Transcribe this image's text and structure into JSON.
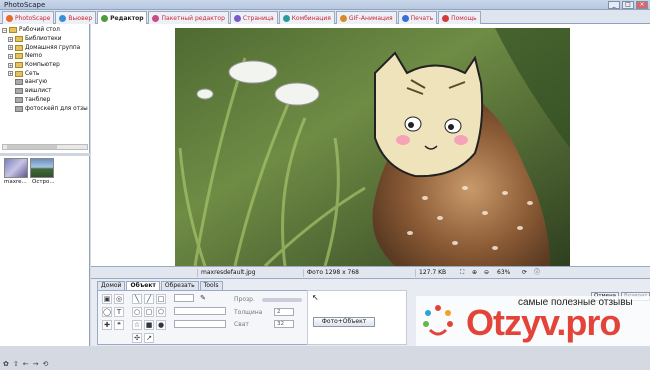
{
  "window": {
    "title": "PhotoScape",
    "controls": [
      "_",
      "□",
      "×"
    ]
  },
  "tabs": [
    {
      "label": "PhotoScape",
      "color": "#e86a2c"
    },
    {
      "label": "Вьювер",
      "color": "#3a8fd6"
    },
    {
      "label": "Редактор",
      "color": "#4c9c3a",
      "active": true
    },
    {
      "label": "Пакетный редактор",
      "color": "#c94b8c"
    },
    {
      "label": "Страница",
      "color": "#7a5bc7"
    },
    {
      "label": "Комбинация",
      "color": "#2b9c9c"
    },
    {
      "label": "GIF-Анимация",
      "color": "#d68a2b"
    },
    {
      "label": "Печать",
      "color": "#3a6fd6"
    },
    {
      "label": "Помощь",
      "color": "#d63a3a"
    }
  ],
  "tree": [
    {
      "label": "Рабочий стол",
      "exp": "−",
      "icon": "desktop-icon"
    },
    {
      "label": "Библиотеки",
      "exp": "+",
      "icon": "folder-icon"
    },
    {
      "label": "Домашняя группа",
      "exp": "+",
      "icon": "folder-icon"
    },
    {
      "label": "Nemo",
      "exp": "+",
      "icon": "folder-icon"
    },
    {
      "label": "Компьютер",
      "exp": "+",
      "icon": "computer-icon"
    },
    {
      "label": "Сеть",
      "exp": "+",
      "icon": "network-icon"
    },
    {
      "label": "вангую",
      "exp": "",
      "icon": "folder-icon"
    },
    {
      "label": "вишлист",
      "exp": "",
      "icon": "folder-icon"
    },
    {
      "label": "танблер",
      "exp": "",
      "icon": "folder-icon"
    },
    {
      "label": "фотоскейп для отзы",
      "exp": "",
      "icon": "folder-icon"
    }
  ],
  "thumbs": [
    {
      "label": "maxre..."
    },
    {
      "label": "Остро..."
    }
  ],
  "status": {
    "filename": "maxresdefault.jpg",
    "dimensions": "Фото 1298 x 768",
    "filesize": "127.7 KB",
    "zoom": "63%"
  },
  "bottom_tabs": [
    "Домой",
    "Объект",
    "Обрезать",
    "Tools"
  ],
  "controls": {
    "opacity_label": "Прозр.",
    "thickness_label": "Толщина",
    "thickness_value": "2",
    "blur_label": "Сват",
    "blur_value": "32",
    "photo_object_button": "Фото+Объект"
  },
  "right_buttons": {
    "cancel": "Отмена",
    "save": "Возврат"
  },
  "watermark": {
    "tagline": "самые полезные отзывы",
    "brand": "Otzyv.pro"
  },
  "left_tools": [
    "✿",
    "⇧",
    "←",
    "→",
    "⟲"
  ]
}
